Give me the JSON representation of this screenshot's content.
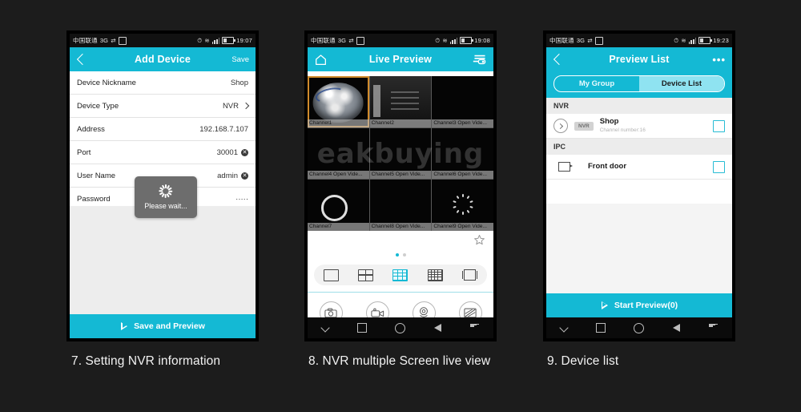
{
  "page": {
    "background": "#1c1c1c",
    "accent": "#14b9d4"
  },
  "phones": [
    {
      "status": {
        "carrier": "中国联通",
        "network": "3G",
        "time": "19:07"
      },
      "title": "Add Device",
      "left_action": "back",
      "right_action": "Save",
      "rows": [
        {
          "label": "Device Nickname",
          "value": "Shop",
          "clear": false,
          "chevron": false
        },
        {
          "label": "Device Type",
          "value": "NVR",
          "clear": false,
          "chevron": true
        },
        {
          "label": "Address",
          "value": "192.168.7.107",
          "clear": false,
          "chevron": false
        },
        {
          "label": "Port",
          "value": "30001",
          "clear": true,
          "chevron": false
        },
        {
          "label": "User Name",
          "value": "admin",
          "clear": true,
          "chevron": false
        },
        {
          "label": "Password",
          "value": "·····",
          "clear": false,
          "chevron": false
        }
      ],
      "toast": "Please wait...",
      "cta": "Save and Preview"
    },
    {
      "status": {
        "carrier": "中国联通",
        "network": "3G",
        "time": "19:08"
      },
      "title": "Live Preview",
      "left_action": "home",
      "right_action": "playback-list",
      "channels": [
        {
          "caption": "Channel1",
          "selected": true,
          "content": "dome"
        },
        {
          "caption": "Channel2",
          "selected": false,
          "content": "room"
        },
        {
          "caption": "Channel3 Open Vide...",
          "selected": false,
          "content": "black"
        },
        {
          "caption": "Channel4 Open Vide...",
          "selected": false,
          "content": "black"
        },
        {
          "caption": "Channel5 Open Vide...",
          "selected": false,
          "content": "black"
        },
        {
          "caption": "Channel6 Open Vide...",
          "selected": false,
          "content": "black"
        },
        {
          "caption": "Channel7",
          "selected": false,
          "content": "ring"
        },
        {
          "caption": "Channel8 Open Vide...",
          "selected": false,
          "content": "black"
        },
        {
          "caption": "Channel9 Open Vide...",
          "selected": false,
          "content": "dots"
        }
      ],
      "watermark": "eakbuying",
      "layouts": [
        {
          "name": "single",
          "active": false
        },
        {
          "name": "four",
          "active": false
        },
        {
          "name": "nine",
          "active": true
        },
        {
          "name": "sixteen",
          "active": false
        },
        {
          "name": "fullscreen",
          "active": false
        }
      ],
      "pager": {
        "pages": 2,
        "current": 1
      },
      "actions": [
        {
          "name": "snapshot-button"
        },
        {
          "name": "record-button"
        },
        {
          "name": "ptz-button"
        },
        {
          "name": "image-button"
        }
      ],
      "favorite": "favorite-star"
    },
    {
      "status": {
        "carrier": "中国联通",
        "network": "3G",
        "time": "19:23"
      },
      "title": "Preview List",
      "left_action": "back",
      "right_action": "more",
      "tabs": [
        {
          "label": "My Group",
          "active": false
        },
        {
          "label": "Device List",
          "active": true
        }
      ],
      "groups": [
        {
          "header": "NVR",
          "items": [
            {
              "name": "Shop",
              "sub": "Channel number:16",
              "badge": "NVR",
              "expandable": true,
              "checked": false
            }
          ]
        },
        {
          "header": "IPC",
          "items": [
            {
              "name": "Front door",
              "sub": "",
              "badge": "",
              "expandable": false,
              "checked": false
            }
          ]
        }
      ],
      "cta": "Start Preview(0)"
    }
  ],
  "captions": [
    "7. Setting NVR information",
    "8. NVR multiple Screen live view",
    "9. Device list"
  ]
}
